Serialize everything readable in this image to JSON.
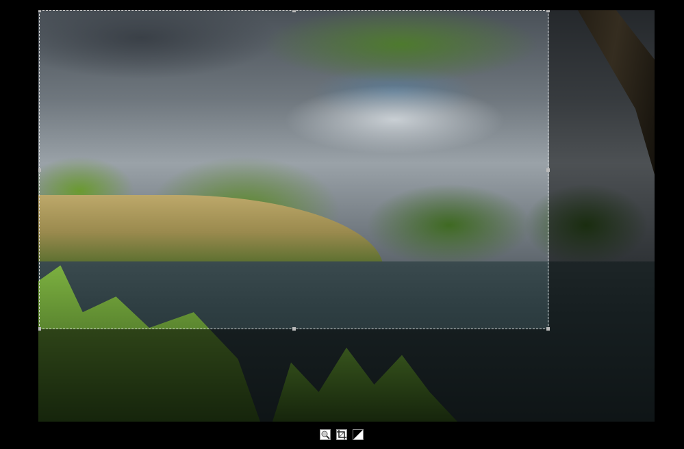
{
  "editor": {
    "mode": "crop",
    "image_subject": "lake landscape"
  },
  "toolbar": {
    "buttons": [
      {
        "name": "zoom",
        "icon": "magnifier-icon"
      },
      {
        "name": "crop",
        "icon": "crop-icon"
      },
      {
        "name": "contrast",
        "icon": "contrast-icon"
      }
    ]
  }
}
